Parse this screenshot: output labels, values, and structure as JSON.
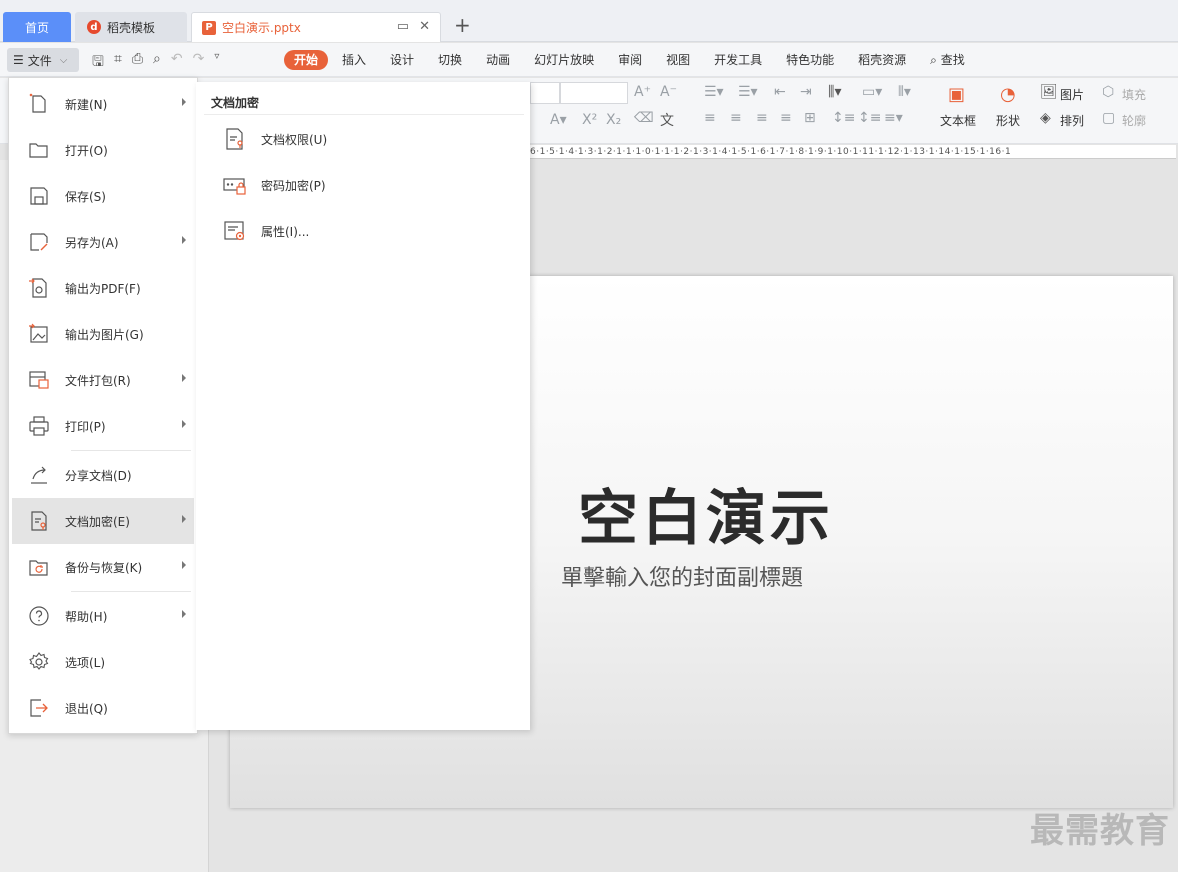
{
  "tabs": {
    "home": "首页",
    "template": "稻壳模板",
    "doc": "空白演示.pptx",
    "new_tab": "+"
  },
  "menubar": {
    "file": "文件",
    "items": [
      "开始",
      "插入",
      "设计",
      "切换",
      "动画",
      "幻灯片放映",
      "审阅",
      "视图",
      "开发工具",
      "特色功能",
      "稻壳资源",
      "查找"
    ]
  },
  "ribbon": {
    "textbox": "文本框",
    "shape": "形状",
    "picture": "图片",
    "arrange": "排列",
    "fill": "填充",
    "outline": "轮廓"
  },
  "ruler_text": "6·1·5·1·4·1·3·1·2·1·1·1·0·1·1·1·2·1·3·1·4·1·5·1·6·1·7·1·8·1·9·1·10·1·11·1·12·1·13·1·14·1·15·1·16·1",
  "file_menu": [
    {
      "label": "新建(N)",
      "icon": "new-file-icon",
      "arrow": true
    },
    {
      "label": "打开(O)",
      "icon": "folder-open-icon",
      "arrow": false
    },
    {
      "label": "保存(S)",
      "icon": "save-icon",
      "arrow": false
    },
    {
      "label": "另存为(A)",
      "icon": "save-as-icon",
      "arrow": true
    },
    {
      "label": "输出为PDF(F)",
      "icon": "export-pdf-icon",
      "arrow": false
    },
    {
      "label": "输出为图片(G)",
      "icon": "export-image-icon",
      "arrow": false
    },
    {
      "label": "文件打包(R)",
      "icon": "package-icon",
      "arrow": true
    },
    {
      "label": "打印(P)",
      "icon": "print-icon",
      "arrow": true
    },
    {
      "label": "分享文档(D)",
      "icon": "share-icon",
      "arrow": false
    },
    {
      "label": "文档加密(E)",
      "icon": "encrypt-icon",
      "arrow": true
    },
    {
      "label": "备份与恢复(K)",
      "icon": "backup-icon",
      "arrow": true
    },
    {
      "label": "帮助(H)",
      "icon": "help-icon",
      "arrow": true
    },
    {
      "label": "选项(L)",
      "icon": "settings-icon",
      "arrow": false
    },
    {
      "label": "退出(Q)",
      "icon": "exit-icon",
      "arrow": false
    }
  ],
  "submenu": {
    "heading": "文档加密",
    "items": [
      {
        "label": "文档权限(U)",
        "icon": "doc-permission-icon"
      },
      {
        "label": "密码加密(P)",
        "icon": "password-lock-icon"
      },
      {
        "label": "属性(I)...",
        "icon": "properties-icon"
      }
    ]
  },
  "slide": {
    "title": "空白演示",
    "subtitle": "單擊輸入您的封面副標題"
  },
  "watermark": "最需教育",
  "colors": {
    "accent": "#e8623a",
    "home_tab": "#5b8ff9"
  }
}
